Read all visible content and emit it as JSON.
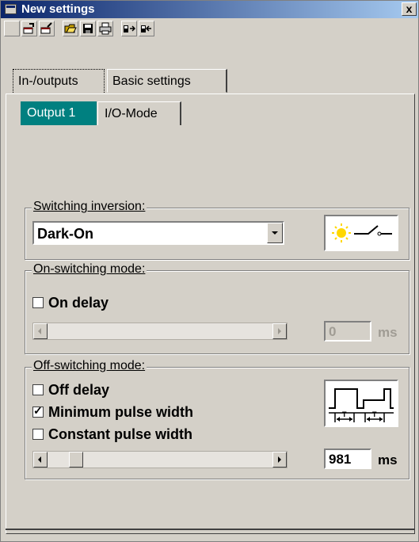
{
  "window": {
    "title": "New settings",
    "close_label": "x"
  },
  "toolbar": {
    "buttons": [
      {
        "icon": "blank-icon"
      },
      {
        "icon": "window-arrow-in-icon"
      },
      {
        "icon": "window-arrow-out-icon"
      },
      {
        "icon": "open-folder-icon"
      },
      {
        "icon": "save-disk-icon"
      },
      {
        "icon": "print-icon"
      },
      {
        "icon": "device-upload-icon"
      },
      {
        "icon": "device-download-icon"
      }
    ]
  },
  "tabs": [
    "In-/outputs",
    "Basic settings"
  ],
  "subtabs": [
    "Output 1",
    "I/O-Mode"
  ],
  "switching_inversion": {
    "label": "Switching inversion:",
    "value": "Dark-On",
    "icon": "light-switch-icon"
  },
  "on_switching": {
    "label": "On-switching mode:",
    "on_delay": {
      "label": "On delay",
      "checked": false
    },
    "value": "0",
    "unit": "ms",
    "enabled": false
  },
  "off_switching": {
    "label": "Off-switching mode:",
    "off_delay": {
      "label": "Off delay",
      "checked": false
    },
    "min_pulse": {
      "label": "Minimum pulse width",
      "checked": true,
      "mark": "✓"
    },
    "constant_pulse": {
      "label": "Constant pulse width",
      "checked": false
    },
    "value": "981",
    "unit": "ms",
    "slider_fraction": 0.1,
    "icon": "pulse-timing-icon"
  }
}
